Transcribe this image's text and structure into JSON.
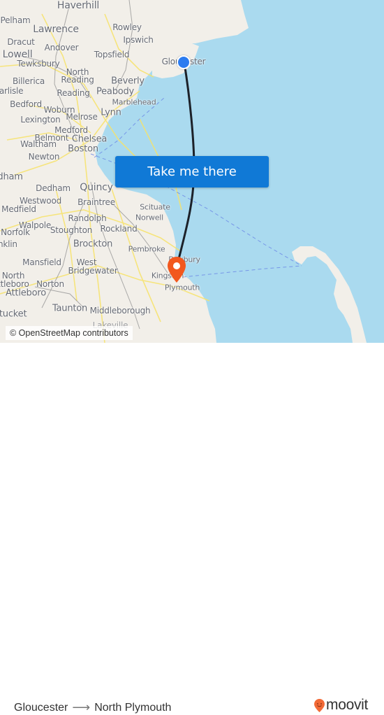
{
  "map": {
    "places": [
      {
        "name": "Haverhill",
        "size": "l"
      },
      {
        "name": "Pelham",
        "size": "s"
      },
      {
        "name": "Lawrence",
        "size": "l"
      },
      {
        "name": "Rowley",
        "size": "s"
      },
      {
        "name": "Ipswich",
        "size": "s"
      },
      {
        "name": "Dracut",
        "size": "s"
      },
      {
        "name": "Andover",
        "size": "s"
      },
      {
        "name": "Lowell",
        "size": "l"
      },
      {
        "name": "Topsfield",
        "size": "s"
      },
      {
        "name": "Tewksbury",
        "size": "s"
      },
      {
        "name": "North",
        "size": "s"
      },
      {
        "name": "Reading",
        "size": "s"
      },
      {
        "name": "Billerica",
        "size": "s"
      },
      {
        "name": "Beverly",
        "size": "m"
      },
      {
        "name": "Carlisle",
        "size": "s"
      },
      {
        "name": "Reading",
        "size": "s"
      },
      {
        "name": "Peabody",
        "size": "m"
      },
      {
        "name": "Marblehead",
        "size": "xs"
      },
      {
        "name": "Bedford",
        "size": "s"
      },
      {
        "name": "Woburn",
        "size": "s"
      },
      {
        "name": "Lynn",
        "size": "m"
      },
      {
        "name": "Lexington",
        "size": "s"
      },
      {
        "name": "Melrose",
        "size": "s"
      },
      {
        "name": "Medford",
        "size": "s"
      },
      {
        "name": "Belmont",
        "size": "s"
      },
      {
        "name": "Chelsea",
        "size": "m"
      },
      {
        "name": "Waltham",
        "size": "s"
      },
      {
        "name": "Boston",
        "size": "m"
      },
      {
        "name": "Newton",
        "size": "s"
      },
      {
        "name": "Needham",
        "size": "m"
      },
      {
        "name": "Dedham",
        "size": "s"
      },
      {
        "name": "Quincy",
        "size": "l"
      },
      {
        "name": "Westwood",
        "size": "s"
      },
      {
        "name": "Braintree",
        "size": "s"
      },
      {
        "name": "Scituate",
        "size": "xs"
      },
      {
        "name": "Medfield",
        "size": "s"
      },
      {
        "name": "Norwell",
        "size": "xs"
      },
      {
        "name": "Randolph",
        "size": "s"
      },
      {
        "name": "Walpole",
        "size": "s"
      },
      {
        "name": "Norfolk",
        "size": "s"
      },
      {
        "name": "Stoughton",
        "size": "s"
      },
      {
        "name": "Rockland",
        "size": "s"
      },
      {
        "name": "Franklin",
        "size": "s"
      },
      {
        "name": "Brockton",
        "size": "m"
      },
      {
        "name": "Pembroke",
        "size": "xs"
      },
      {
        "name": "Mansfield",
        "size": "s"
      },
      {
        "name": "West",
        "size": "s"
      },
      {
        "name": "Bridgewater",
        "size": "s"
      },
      {
        "name": "Duxbury",
        "size": "xs"
      },
      {
        "name": "North",
        "size": "s"
      },
      {
        "name": "Attleboro",
        "size": "s"
      },
      {
        "name": "Norton",
        "size": "s"
      },
      {
        "name": "Kingston",
        "size": "xs"
      },
      {
        "name": "Attleboro",
        "size": "m"
      },
      {
        "name": "Plymouth",
        "size": "xs"
      },
      {
        "name": "Pawtucket",
        "size": "m"
      },
      {
        "name": "Taunton",
        "size": "m"
      },
      {
        "name": "Middleborough",
        "size": "s"
      },
      {
        "name": "Lakeville",
        "size": "s"
      },
      {
        "name": "Gloucester",
        "size": "s"
      }
    ],
    "cta_label": "Take me there",
    "attribution": "© OpenStreetMap contributors",
    "origin_marker": "origin-dot",
    "destination_marker": "destination-pin",
    "route_color": "#1c2129",
    "origin_color": "#2c7cf0",
    "destination_color": "#f2581e",
    "water_color": "#aadaef",
    "land_color": "#f2efe9"
  },
  "footer": {
    "origin": "Gloucester",
    "arrow_icon": "arrow-right-icon",
    "destination": "North Plymouth",
    "brand": "moovit",
    "brand_color": "#f26a36"
  }
}
